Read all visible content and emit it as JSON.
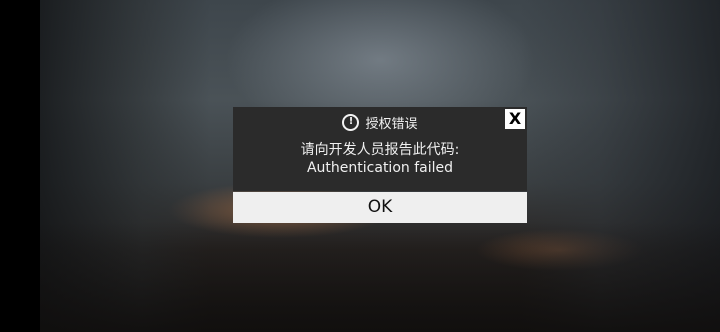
{
  "dialog": {
    "title": "授权错误",
    "close_label": "X",
    "message_line1": "请向开发人员报告此代码:",
    "message_line2": "Authentication failed",
    "ok_label": "OK"
  },
  "icons": {
    "title_icon": "alert-circle-icon"
  },
  "colors": {
    "panel_bg": "#2b2b2b",
    "button_bg": "#efefef",
    "text_light": "#f2f2f2"
  }
}
